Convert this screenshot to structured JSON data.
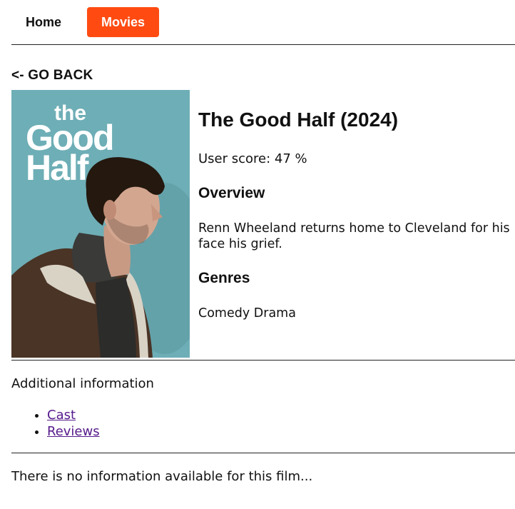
{
  "nav": {
    "items": [
      {
        "label": "Home",
        "active": false
      },
      {
        "label": "Movies",
        "active": true
      }
    ],
    "accent_color": "#ff4b12"
  },
  "back_link": "<- GO BACK",
  "poster": {
    "text_line1": "the",
    "text_line2": "Good",
    "text_line3": "Half"
  },
  "movie": {
    "title": "The Good Half (2024)",
    "user_score": "User score: 47 %",
    "overview_heading": "Overview",
    "overview_line1": "Renn Wheeland returns home to Cleveland for his",
    "overview_line2": "face his grief.",
    "genres_heading": "Genres",
    "genres": "Comedy Drama"
  },
  "additional": {
    "heading": "Additional information",
    "links": [
      {
        "label": "Cast"
      },
      {
        "label": "Reviews"
      }
    ]
  },
  "no_info_text": "There is no information available for this film..."
}
